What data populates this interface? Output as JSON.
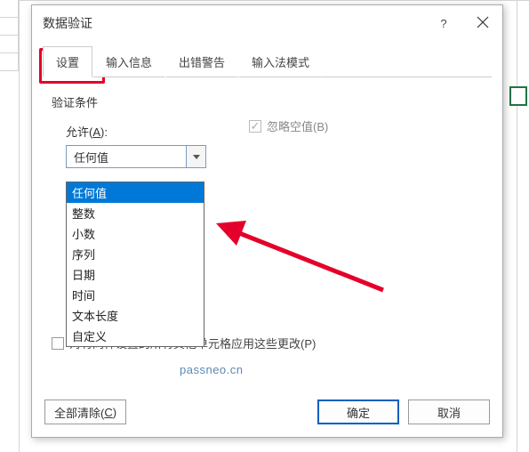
{
  "dialog": {
    "title": "数据验证",
    "help": "?",
    "close": "×"
  },
  "tabs": {
    "t0": "设置",
    "t1": "输入信息",
    "t2": "出错警告",
    "t3": "输入法模式"
  },
  "section": {
    "criteria": "验证条件",
    "allow_prefix": "允许(",
    "allow_key": "A",
    "allow_suffix": "):",
    "ignore_blank_full": "忽略空值(B)"
  },
  "combo": {
    "selected": "任何值"
  },
  "options": {
    "i0": "任何值",
    "i1": "整数",
    "i2": "小数",
    "i3": "序列",
    "i4": "日期",
    "i5": "时间",
    "i6": "文本长度",
    "i7": "自定义"
  },
  "apply": {
    "label": "对有同样设置的所有其他单元格应用这些更改(P)"
  },
  "buttons": {
    "clear_pre": "全部清除(",
    "clear_key": "C",
    "clear_suf": ")",
    "ok": "确定",
    "cancel": "取消"
  },
  "watermark": "passneo.cn",
  "checkmark": "✓"
}
